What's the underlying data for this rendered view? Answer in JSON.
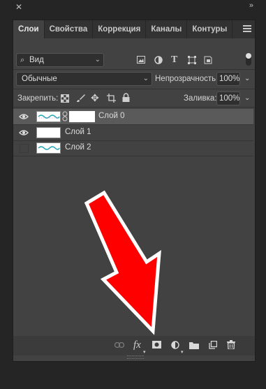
{
  "tabs": [
    "Слои",
    "Свойства",
    "Коррекция",
    "Каналы",
    "Контуры"
  ],
  "filter": {
    "label": "Вид"
  },
  "blend": {
    "mode": "Обычные",
    "opacity_label": "Непрозрачность:",
    "opacity_value": "100%"
  },
  "lock": {
    "label": "Закрепить:",
    "fill_label": "Заливка:",
    "fill_value": "100%"
  },
  "layers": [
    {
      "name": "Слой 0",
      "visible": true,
      "selected": true
    },
    {
      "name": "Слой 1",
      "visible": true,
      "selected": false
    },
    {
      "name": "Слой 2",
      "visible": false,
      "selected": false
    }
  ],
  "bottom_icons": [
    "link-icon",
    "fx-icon",
    "mask-icon",
    "adjustment-icon",
    "folder-icon",
    "new-layer-icon",
    "trash-icon"
  ],
  "fx_text": "fx",
  "annotation": {
    "arrow_color": "#ff0000",
    "outline": "#ffffff"
  }
}
